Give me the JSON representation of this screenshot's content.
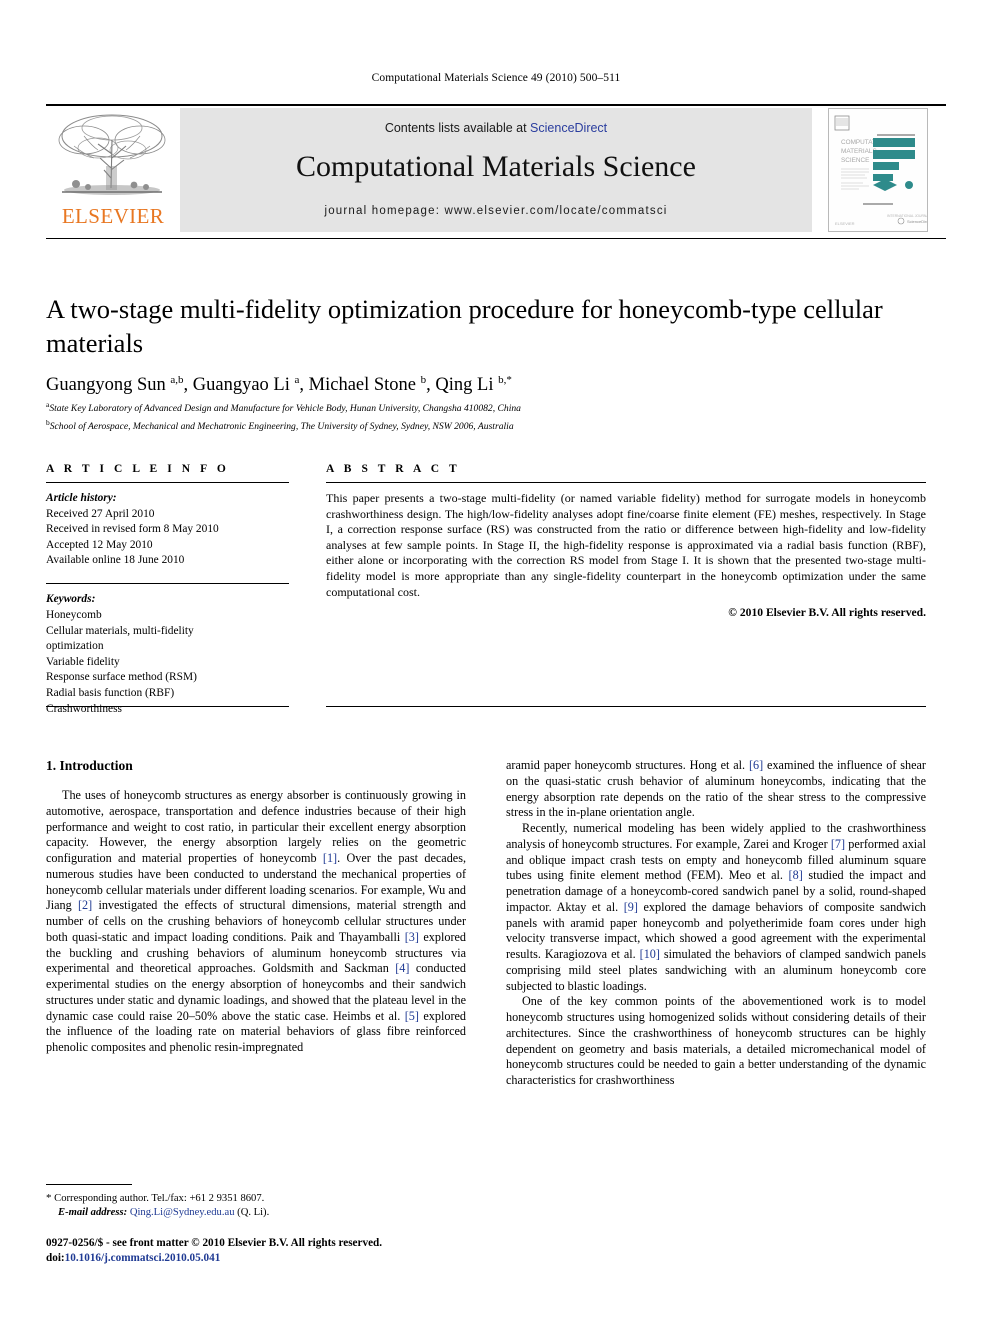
{
  "running_head": "Computational Materials Science 49 (2010) 500–511",
  "header": {
    "contents_prefix": "Contents lists available at ",
    "sciencedirect": "ScienceDirect",
    "journal_title": "Computational Materials Science",
    "homepage": "journal homepage: www.elsevier.com/locate/commatsci",
    "publisher_name": "ELSEVIER",
    "cover_title_lines": [
      "COMPUTATIONAL",
      "MATERIALS",
      "SCIENCE"
    ],
    "accent_color": "#E87722",
    "link_color": "#2a3d9e",
    "band_color": "#e4e4e4",
    "cover_pattern_color": "#2e8b8b"
  },
  "article": {
    "title": "A two-stage multi-fidelity optimization procedure for honeycomb-type cellular materials",
    "authors_html": "Guangyong Sun <sup>a,b</sup>, Guangyao Li <sup>a</sup>, Michael Stone <sup>b</sup>, Qing Li <sup>b,</sup><sup>*</sup>",
    "affiliations": [
      "State Key Laboratory of Advanced Design and Manufacture for Vehicle Body, Hunan University, Changsha 410082, China",
      "School of Aerospace, Mechanical and Mechatronic Engineering, The University of Sydney, Sydney, NSW 2006, Australia"
    ],
    "affiliation_marks": [
      "a",
      "b"
    ]
  },
  "article_info": {
    "heading": "A R T I C L E    I N F O",
    "history_label": "Article history:",
    "history": [
      "Received 27 April 2010",
      "Received in revised form 8 May 2010",
      "Accepted 12 May 2010",
      "Available online 18 June 2010"
    ],
    "keywords_label": "Keywords:",
    "keywords": [
      "Honeycomb",
      "Cellular materials, multi-fidelity",
      "optimization",
      "Variable fidelity",
      "Response surface method (RSM)",
      "Radial basis function (RBF)",
      "Crashworthiness"
    ]
  },
  "abstract": {
    "heading": "A B S T R A C T",
    "text": "This paper presents a two-stage multi-fidelity (or named variable fidelity) method for surrogate models in honeycomb crashworthiness design. The high/low-fidelity analyses adopt fine/coarse finite element (FE) meshes, respectively. In Stage I, a correction response surface (RS) was constructed from the ratio or difference between high-fidelity and low-fidelity analyses at few sample points. In Stage II, the high-fidelity response is approximated via a radial basis function (RBF), either alone or incorporating with the correction RS model from Stage I. It is shown that the presented two-stage multi-fidelity model is more appropriate than any single-fidelity counterpart in the honeycomb optimization under the same computational cost.",
    "copyright": "© 2010 Elsevier B.V. All rights reserved."
  },
  "body": {
    "section_heading": "1. Introduction",
    "left_paragraph_1": "The uses of honeycomb structures as energy absorber is continuously growing in automotive, aerospace, transportation and defence industries because of their high performance and weight to cost ratio, in particular their excellent energy absorption capacity. However, the energy absorption largely relies on the geometric configuration and material properties of honeycomb [1]. Over the past decades, numerous studies have been conducted to understand the mechanical properties of honeycomb cellular materials under different loading scenarios. For example, Wu and Jiang [2] investigated the effects of structural dimensions, material strength and number of cells on the crushing behaviors of honeycomb cellular structures under both quasi-static and impact loading conditions. Paik and Thayamballi [3] explored the buckling and crushing behaviors of aluminum honeycomb structures via experimental and theoretical approaches. Goldsmith and Sackman [4] conducted experimental studies on the energy absorption of honeycombs and their sandwich structures under static and dynamic loadings, and showed that the plateau level in the dynamic case could raise 20–50% above the static case. Heimbs et al. [5] explored the influence of the loading rate on material behaviors of glass fibre reinforced phenolic composites and phenolic resin-impregnated",
    "right_paragraph_1": "aramid paper honeycomb structures. Hong et al. [6] examined the influence of shear on the quasi-static crush behavior of aluminum honeycombs, indicating that the energy absorption rate depends on the ratio of the shear stress to the compressive stress in the in-plane orientation angle.",
    "right_paragraph_2": "Recently, numerical modeling has been widely applied to the crashworthiness analysis of honeycomb structures. For example, Zarei and Kroger [7] performed axial and oblique impact crash tests on empty and honeycomb filled aluminum square tubes using finite element method (FEM). Meo et al. [8] studied the impact and penetration damage of a honeycomb-cored sandwich panel by a solid, round-shaped impactor. Aktay et al. [9] explored the damage behaviors of composite sandwich panels with aramid paper honeycomb and polyetherimide foam cores under high velocity transverse impact, which showed a good agreement with the experimental results. Karagiozova et al. [10] simulated the behaviors of clamped sandwich panels comprising mild steel plates sandwiching with an aluminum honeycomb core subjected to blastic loadings.",
    "right_paragraph_3": "One of the key common points of the abovementioned work is to model honeycomb structures using homogenized solids without considering details of their architectures. Since the crashworthiness of honeycomb structures can be highly dependent on geometry and basis materials, a detailed micromechanical model of honeycomb structures could be needed to gain a better understanding of the dynamic characteristics for crashworthiness"
  },
  "footnote": {
    "marker": "*",
    "corresponding": "Corresponding author. Tel./fax: +61 2 9351 8607.",
    "email_label": "E-mail address:",
    "email": "Qing.Li@Sydney.edu.au",
    "email_suffix": "(Q. Li)."
  },
  "imprint": {
    "line1": "0927-0256/$ - see front matter © 2010 Elsevier B.V. All rights reserved.",
    "doi_prefix": "doi:",
    "doi": "10.1016/j.commatsci.2010.05.041"
  }
}
